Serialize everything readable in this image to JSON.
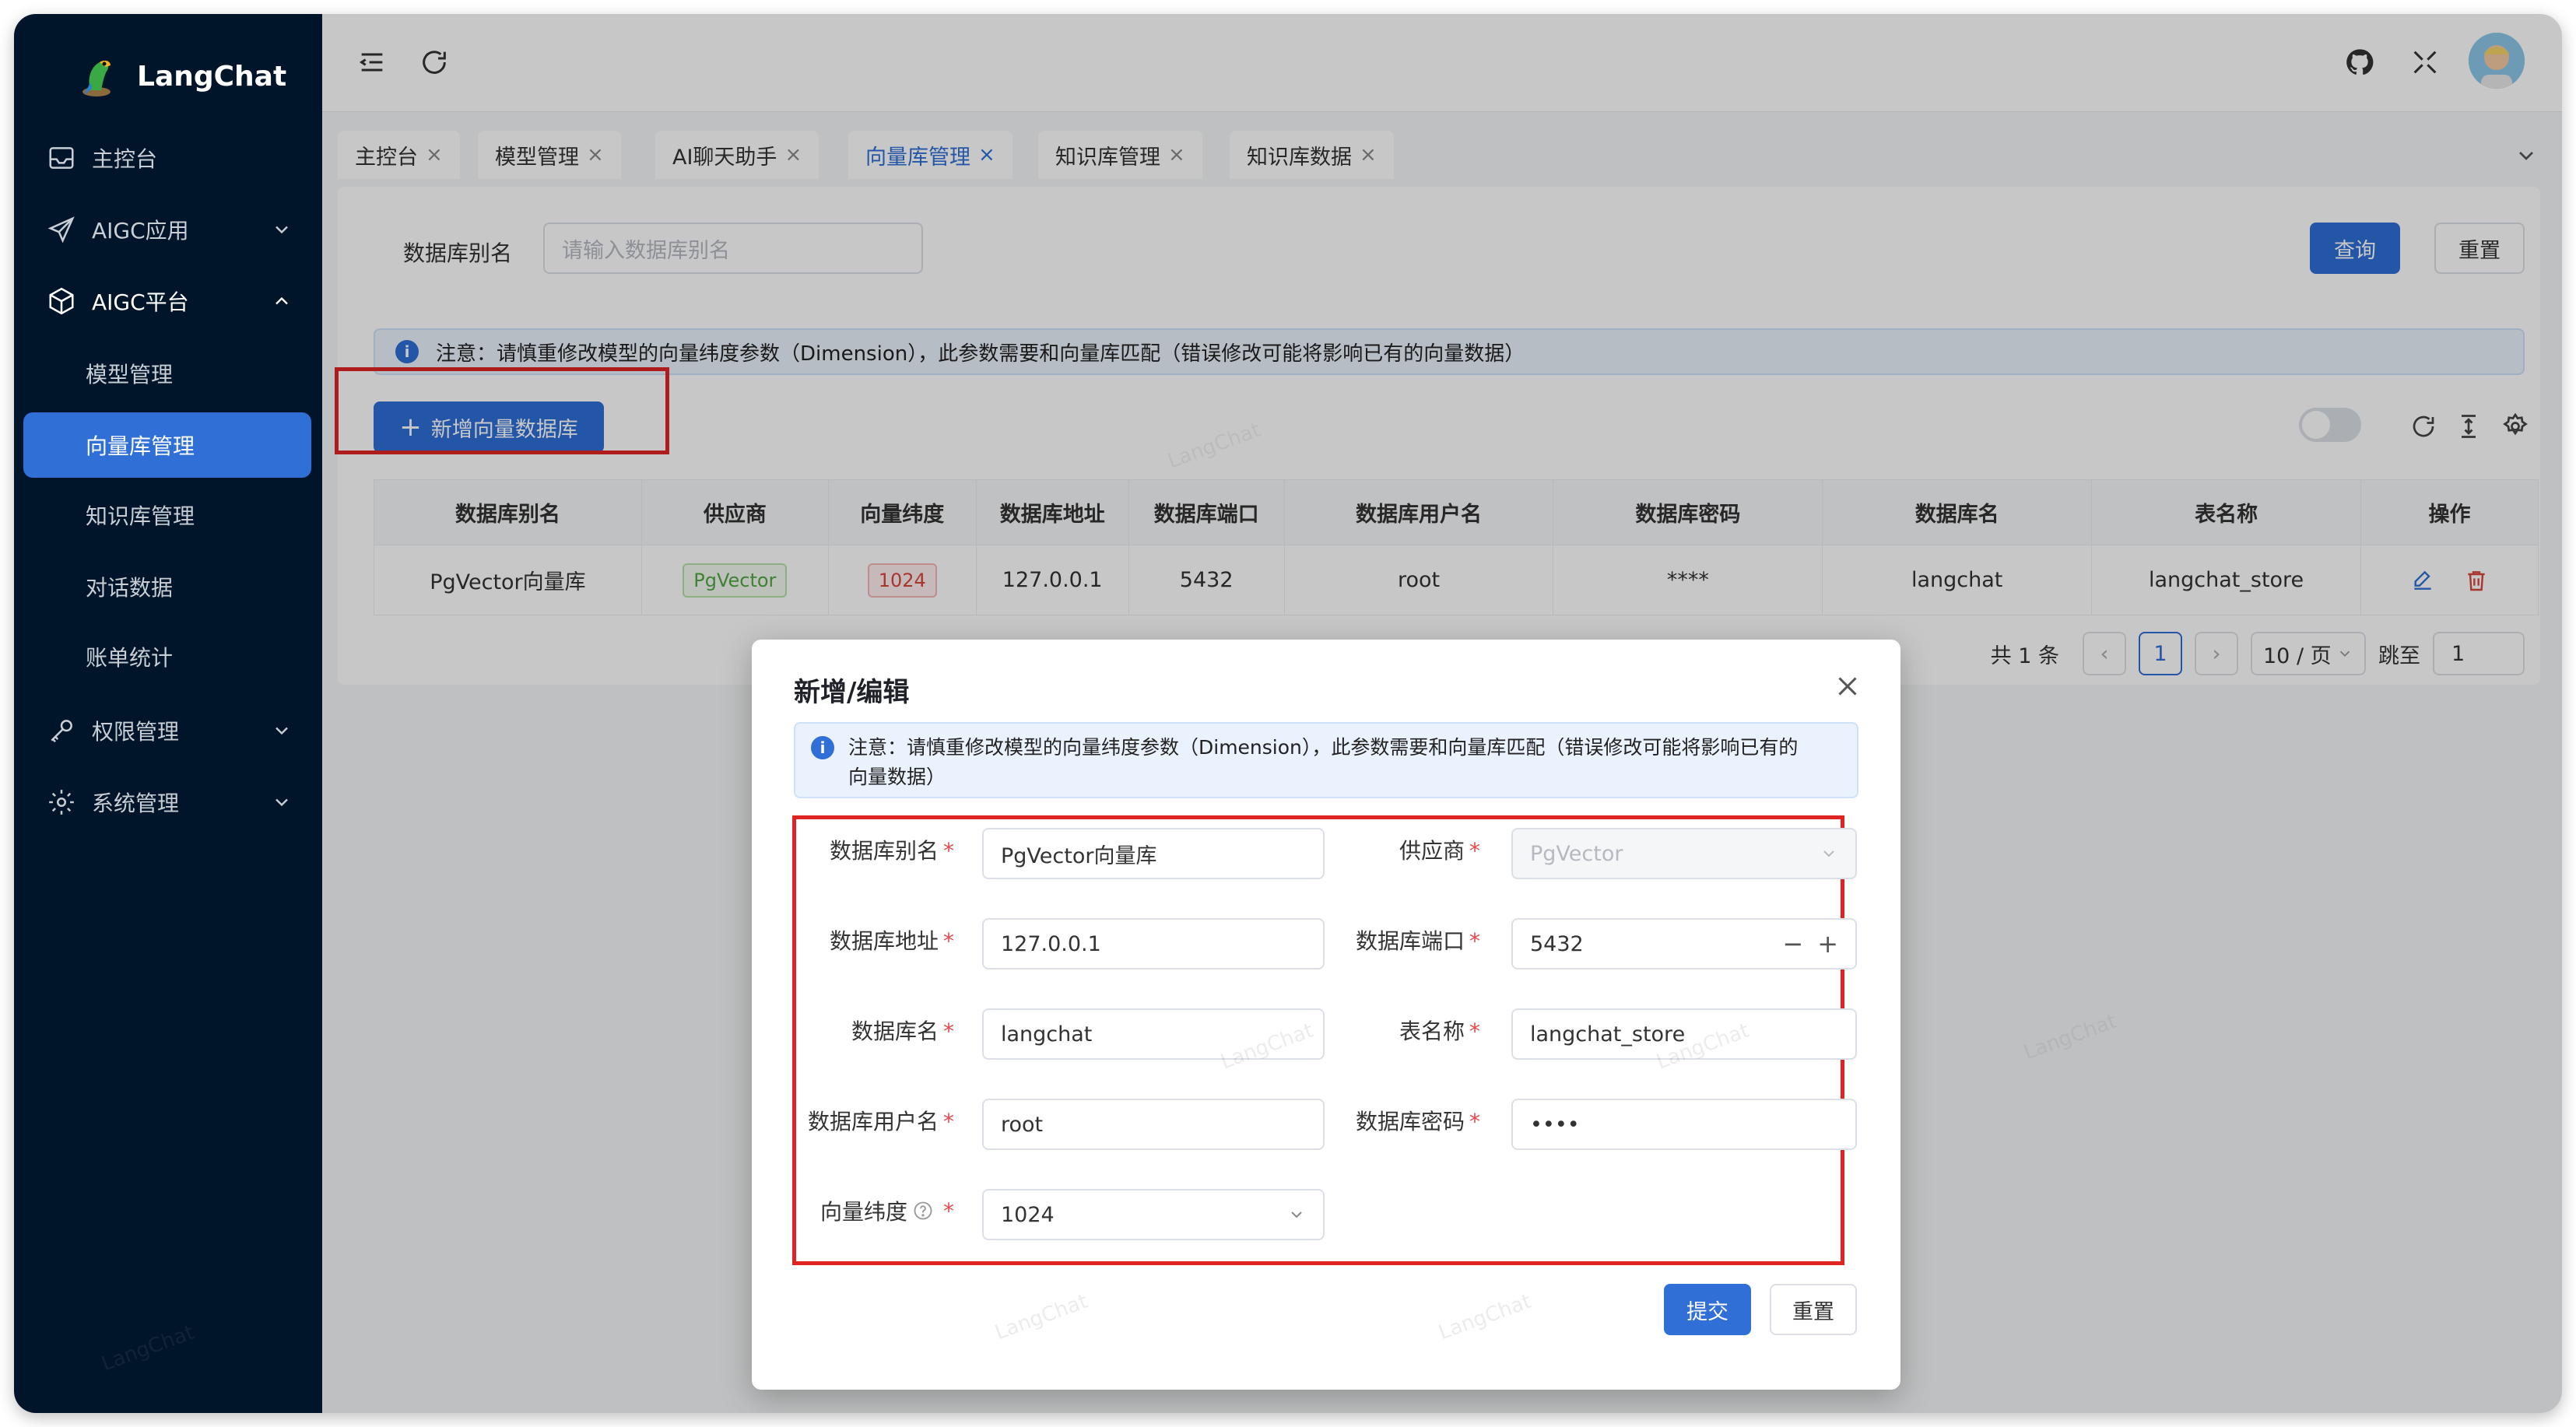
{
  "app": {
    "name": "LangChat",
    "watermark": "LangChat"
  },
  "sidebar": {
    "items": [
      {
        "label": "主控台"
      },
      {
        "label": "AIGC应用"
      },
      {
        "label": "AIGC平台"
      },
      {
        "label": "权限管理"
      },
      {
        "label": "系统管理"
      }
    ],
    "submenu": [
      {
        "label": "模型管理"
      },
      {
        "label": "向量库管理"
      },
      {
        "label": "知识库管理"
      },
      {
        "label": "对话数据"
      },
      {
        "label": "账单统计"
      }
    ]
  },
  "tabs": [
    {
      "label": "主控台"
    },
    {
      "label": "模型管理"
    },
    {
      "label": "AI聊天助手"
    },
    {
      "label": "向量库管理"
    },
    {
      "label": "知识库管理"
    },
    {
      "label": "知识库数据"
    }
  ],
  "search": {
    "label": "数据库别名",
    "placeholder": "请输入数据库别名",
    "query_button": "查询",
    "reset_button": "重置"
  },
  "notice": "注意：请慎重修改模型的向量纬度参数（Dimension），此参数需要和向量库匹配（错误修改可能将影响已有的向量数据）",
  "add_button": "新增向量数据库",
  "table": {
    "columns": [
      "数据库别名",
      "供应商",
      "向量纬度",
      "数据库地址",
      "数据库端口",
      "数据库用户名",
      "数据库密码",
      "数据库名",
      "表名称",
      "操作"
    ],
    "rows": [
      {
        "alias": "PgVector向量库",
        "provider": "PgVector",
        "dimension": "1024",
        "host": "127.0.0.1",
        "port": "5432",
        "user": "root",
        "password": "****",
        "database": "langchat",
        "table": "langchat_store"
      }
    ]
  },
  "pagination": {
    "total": "共 1 条",
    "current": "1",
    "page_size": "10 / 页",
    "jump_label": "跳至",
    "jump_value": "1"
  },
  "modal": {
    "title": "新增/编辑",
    "notice_line1": "注意：请慎重修改模型的向量纬度参数（Dimension），此参数需要和向量库匹配（错误修改可能将影响已有的",
    "notice_line2": "向量数据）",
    "fields": {
      "alias": {
        "label": "数据库别名",
        "value": "PgVector向量库"
      },
      "provider": {
        "label": "供应商",
        "value": "PgVector"
      },
      "host": {
        "label": "数据库地址",
        "value": "127.0.0.1"
      },
      "port": {
        "label": "数据库端口",
        "value": "5432"
      },
      "database": {
        "label": "数据库名",
        "value": "langchat"
      },
      "table": {
        "label": "表名称",
        "value": "langchat_store"
      },
      "user": {
        "label": "数据库用户名",
        "value": "root"
      },
      "password": {
        "label": "数据库密码",
        "value": "••••"
      },
      "dimension": {
        "label": "向量纬度",
        "value": "1024"
      }
    },
    "required_mark": "*",
    "submit_button": "提交",
    "reset_button": "重置"
  },
  "colors": {
    "primary": "#2f6fd6",
    "sidebar": "#001529",
    "highlight": "#e02424"
  }
}
